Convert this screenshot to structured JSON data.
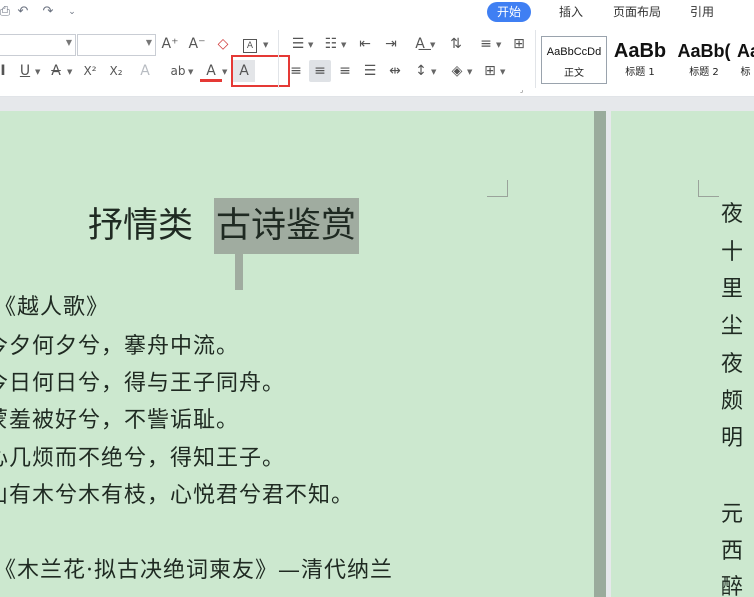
{
  "menu": {
    "tabs": [
      {
        "label": "开始",
        "active": true
      },
      {
        "label": "插入",
        "active": false
      },
      {
        "label": "页面布局",
        "active": false
      },
      {
        "label": "引用",
        "active": false
      }
    ],
    "accent_color": "#3f7ff3"
  },
  "quick_access": {
    "icons": [
      "print-icon",
      "undo-icon",
      "redo-icon",
      "customize-dropdown-icon"
    ]
  },
  "ribbon": {
    "font_name_value": "",
    "font_size_value": "",
    "grow_font": "A⁺",
    "shrink_font": "A⁻",
    "clear_format": "◇",
    "char_border": "A",
    "underline": "U",
    "strikethrough": "A",
    "superscript": "X²",
    "subscript": "X₂",
    "text_effect": "A",
    "highlight": "ab",
    "font_color": "A",
    "char_shading": "A",
    "highlight_color": "#e53935"
  },
  "styles": [
    {
      "sample": "AaBbCcDd",
      "label": "正文"
    },
    {
      "sample": "AaBb",
      "label": "标题 1"
    },
    {
      "sample": "AaBb(",
      "label": "标题 2"
    },
    {
      "sample": "Aa",
      "label": "标"
    }
  ],
  "document": {
    "page_color": "#cce8cf",
    "title_plain": "抒情类",
    "title_selected": "古诗鉴赏",
    "lines": [
      "《越人歌》",
      "今夕何夕兮，搴舟中流。",
      "今日何日兮，得与王子同舟。",
      "蒙羞被好兮，不訾诟耻。",
      "心几烦而不绝兮，得知王子。",
      "山有木兮木有枝，心悦君兮君不知。",
      "《木兰花·拟古决绝词柬友》—清代纳兰"
    ],
    "page2_lines": [
      "夜",
      "十",
      "里",
      "尘",
      "夜",
      "颇",
      "明",
      "元",
      "西",
      "醉"
    ]
  }
}
